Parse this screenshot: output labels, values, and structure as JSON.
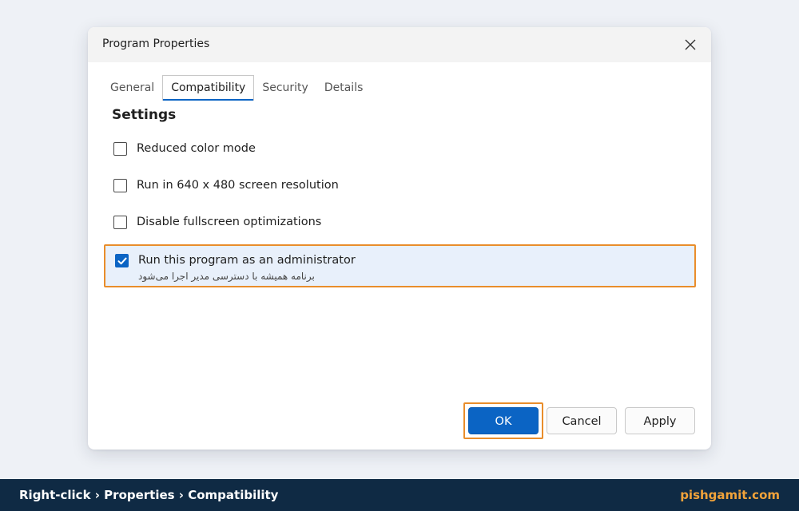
{
  "dialog": {
    "title": "Program Properties",
    "close_icon": "close-icon"
  },
  "tabs": [
    {
      "label": "General",
      "active": false
    },
    {
      "label": "Compatibility",
      "active": true
    },
    {
      "label": "Security",
      "active": false
    },
    {
      "label": "Details",
      "active": false
    }
  ],
  "settings": {
    "title": "Settings",
    "options": [
      {
        "label": "Reduced color mode",
        "checked": false
      },
      {
        "label": "Run in 640 x 480 screen resolution",
        "checked": false
      },
      {
        "label": "Disable fullscreen optimizations",
        "checked": false
      },
      {
        "label": "Run this program as an administrator",
        "checked": true,
        "sublabel": "برنامه همیشه با دسترسی مدیر اجرا می‌شود"
      }
    ]
  },
  "buttons": {
    "ok": "OK",
    "cancel": "Cancel",
    "apply": "Apply"
  },
  "footer": {
    "path": "Right-click › Properties › Compatibility",
    "brand": "pishgamit.com"
  },
  "colors": {
    "accent": "#0b64c4",
    "highlight": "#e98d2b",
    "footer_bg": "#0f2a44",
    "brand": "#f2a33a"
  }
}
